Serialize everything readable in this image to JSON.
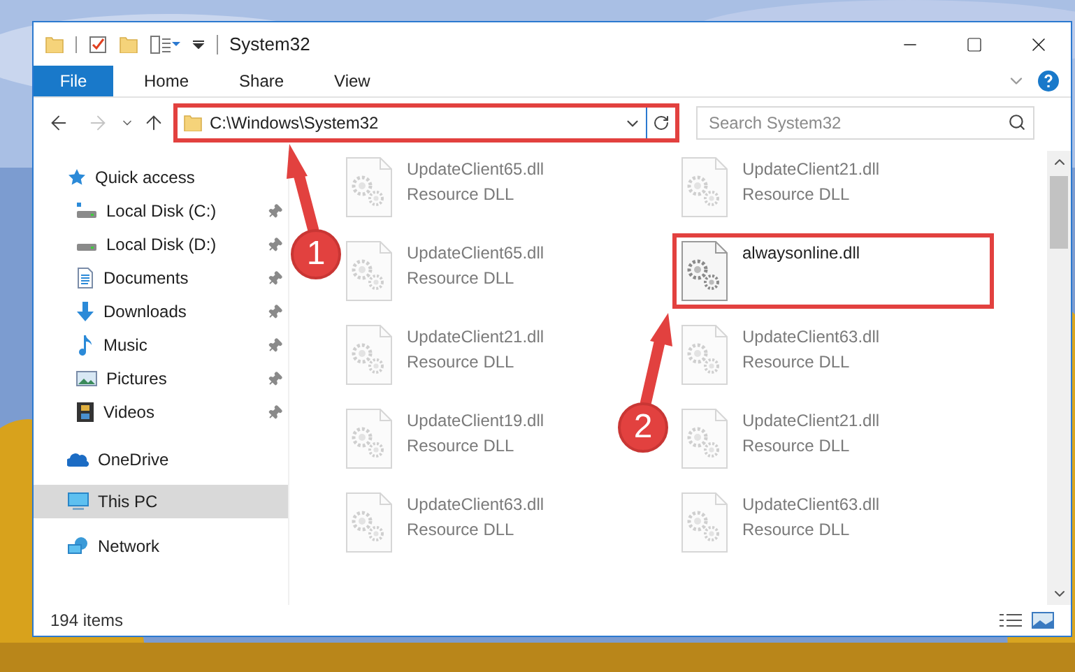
{
  "window": {
    "title": "System32"
  },
  "ribbon_tabs": [
    {
      "label": "File",
      "selected": true
    },
    {
      "label": "Home",
      "selected": false
    },
    {
      "label": "Share",
      "selected": false
    },
    {
      "label": "View",
      "selected": false
    }
  ],
  "address_bar": {
    "path": "C:\\Windows\\System32",
    "highlighted": true
  },
  "search": {
    "placeholder": "Search System32"
  },
  "sidebar": {
    "items": [
      {
        "label": "Quick access",
        "selected": false,
        "children": [
          {
            "label": "Local Disk (C:)",
            "pinned": true
          },
          {
            "label": "Local Disk (D:)",
            "pinned": true
          },
          {
            "label": "Documents",
            "pinned": true
          },
          {
            "label": "Downloads",
            "pinned": true
          },
          {
            "label": "Music",
            "pinned": true
          },
          {
            "label": "Pictures",
            "pinned": true
          },
          {
            "label": "Videos",
            "pinned": true
          }
        ]
      },
      {
        "label": "OneDrive",
        "selected": false
      },
      {
        "label": "This PC",
        "selected": true
      },
      {
        "label": "Network",
        "selected": false
      }
    ]
  },
  "files": [
    {
      "name": "UpdateClient65.dll",
      "type": "Resource DLL",
      "blurred": true,
      "highlighted": false
    },
    {
      "name": "UpdateClient21.dll",
      "type": "Resource DLL",
      "blurred": true,
      "highlighted": false
    },
    {
      "name": "UpdateClient65.dll",
      "type": "Resource DLL",
      "blurred": true,
      "highlighted": false
    },
    {
      "name": "alwaysonline.dll",
      "blurred": false,
      "highlighted": true
    },
    {
      "name": "UpdateClient21.dll",
      "type": "Resource DLL",
      "blurred": true,
      "highlighted": false
    },
    {
      "name": "UpdateClient63.dll",
      "type": "Resource DLL",
      "blurred": true,
      "highlighted": false
    },
    {
      "name": "UpdateClient19.dll",
      "type": "Resource DLL",
      "blurred": true,
      "highlighted": false
    },
    {
      "name": "UpdateClient21.dll",
      "type": "Resource DLL",
      "blurred": true,
      "highlighted": false
    },
    {
      "name": "UpdateClient63.dll",
      "type": "Resource DLL",
      "blurred": true,
      "highlighted": false
    },
    {
      "name": "UpdateClient63.dll",
      "type": "Resource DLL",
      "blurred": true,
      "highlighted": false
    }
  ],
  "status_bar": {
    "item_count": "194 items"
  },
  "annotations": [
    {
      "label": "1"
    },
    {
      "label": "2"
    }
  ]
}
